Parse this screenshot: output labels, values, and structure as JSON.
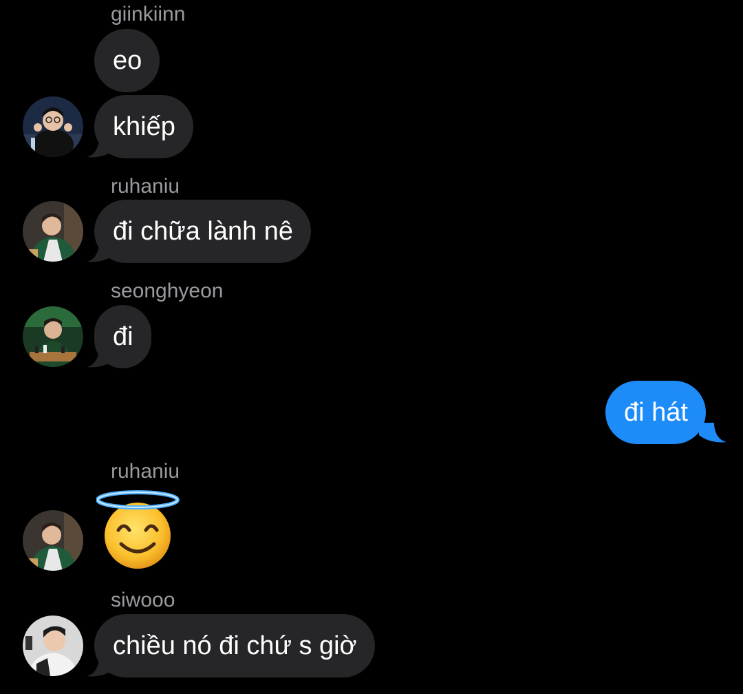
{
  "chat": {
    "messages": [
      {
        "sender": "giinkiinn",
        "text": "eo"
      },
      {
        "text": "khiếp"
      },
      {
        "sender": "ruhaniu",
        "text": "đi chữa lành nê"
      },
      {
        "sender": "seonghyeon",
        "text": "đi"
      },
      {
        "text": "đi hát",
        "outgoing": true
      },
      {
        "sender": "ruhaniu",
        "emoji": "smiling-face-with-halo"
      },
      {
        "sender": "siwooo",
        "text": "chiều nó đi chứ s giờ"
      }
    ]
  },
  "colors": {
    "background": "#000000",
    "incoming_bubble": "#262628",
    "outgoing_bubble": "#1d8cf8",
    "sender_name": "#9a9a9f"
  }
}
